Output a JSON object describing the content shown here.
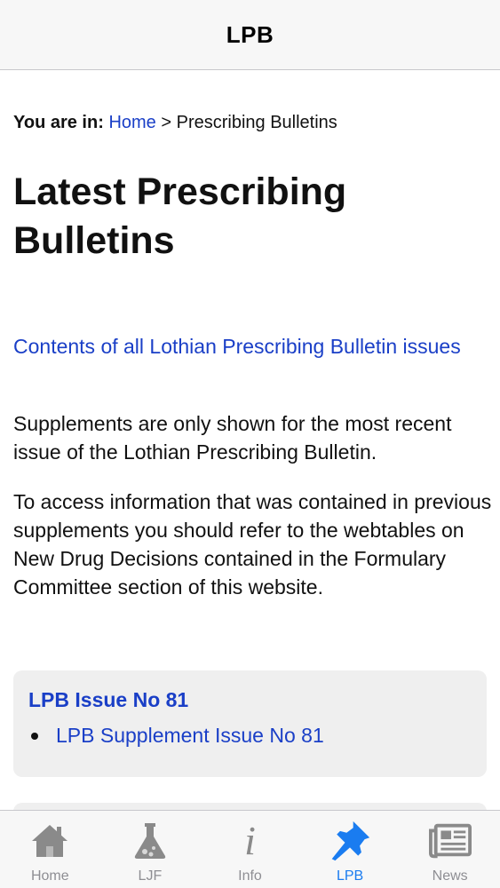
{
  "navbar": {
    "title": "LPB"
  },
  "breadcrumb": {
    "label": "You are in:",
    "home_link": "Home",
    "separator": ">",
    "current": "Prescribing Bulletins"
  },
  "page": {
    "title": "Latest Prescribing Bulletins",
    "contents_link": "Contents of all Lothian Prescribing Bulletin issues",
    "paragraphs": [
      "Supplements are only shown for the most recent issue of the Lothian Prescribing Bulletin.",
      "To access information that was contained in previous supplements you should refer to the webtables on New Drug Decisions contained in the Formulary Committee section of this website."
    ]
  },
  "issues": [
    {
      "title": "LPB Issue No 81",
      "items": [
        "LPB Supplement Issue No 81"
      ]
    }
  ],
  "tabbar": {
    "tabs": [
      {
        "label": "Home",
        "icon": "home-icon",
        "active": false
      },
      {
        "label": "LJF",
        "icon": "flask-icon",
        "active": false
      },
      {
        "label": "Info",
        "icon": "info-icon",
        "active": false
      },
      {
        "label": "LPB",
        "icon": "pin-icon",
        "active": true
      },
      {
        "label": "News",
        "icon": "newspaper-icon",
        "active": false
      }
    ]
  },
  "colors": {
    "link": "#1a3fc7",
    "active_tab": "#1a7cf0",
    "inactive_tab": "#8e8e93",
    "card_background": "#efefef"
  }
}
